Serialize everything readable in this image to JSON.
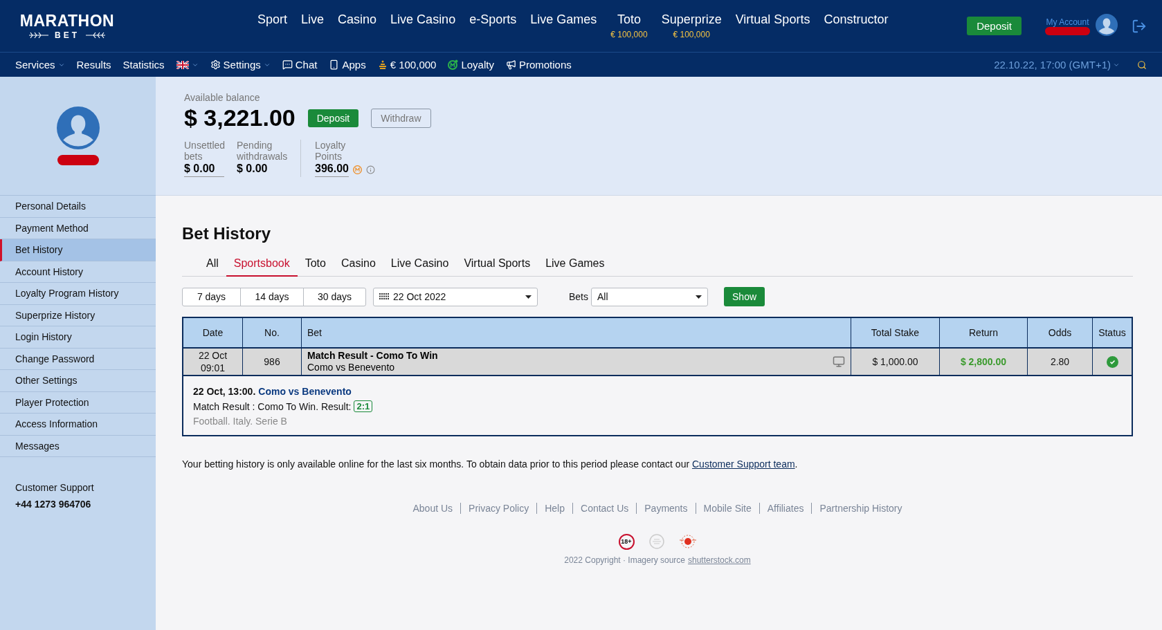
{
  "header": {
    "logo": {
      "title": "MARATHON",
      "subtitle": "BET"
    },
    "nav": [
      {
        "label": "Sport"
      },
      {
        "label": "Live"
      },
      {
        "label": "Casino"
      },
      {
        "label": "Live Casino"
      },
      {
        "label": "e-Sports"
      },
      {
        "label": "Live Games"
      },
      {
        "label": "Toto",
        "sub": "€ 100,000"
      },
      {
        "label": "Superprize",
        "sub": "€ 100,000"
      },
      {
        "label": "Virtual Sports"
      },
      {
        "label": "Constructor"
      }
    ],
    "deposit": "Deposit",
    "account_label": "My Account"
  },
  "subnav": {
    "items": [
      {
        "kind": "dropdown",
        "label": "Services"
      },
      {
        "kind": "link",
        "label": "Results"
      },
      {
        "kind": "link",
        "label": "Statistics"
      },
      {
        "kind": "flag"
      },
      {
        "kind": "settings",
        "label": "Settings"
      },
      {
        "kind": "chat",
        "label": "Chat"
      },
      {
        "kind": "apps",
        "label": "Apps"
      },
      {
        "kind": "jackpot",
        "label": "€ 100,000"
      },
      {
        "kind": "loyalty",
        "label": "Loyalty"
      },
      {
        "kind": "promotions",
        "label": "Promotions"
      }
    ],
    "datetime": "22.10.22, 17:00 (GMT+1)"
  },
  "sidebar": {
    "items": [
      {
        "label": "Personal Details",
        "selected": false
      },
      {
        "label": "Payment Method",
        "selected": false
      },
      {
        "label": "Bet History",
        "selected": true
      },
      {
        "label": "Account History",
        "selected": false
      },
      {
        "label": "Loyalty Program History",
        "selected": false
      },
      {
        "label": "Superprize History",
        "selected": false
      },
      {
        "label": "Login History",
        "selected": false
      },
      {
        "label": "Change Password",
        "selected": false
      },
      {
        "label": "Other Settings",
        "selected": false
      },
      {
        "label": "Player Protection",
        "selected": false
      },
      {
        "label": "Access Information",
        "selected": false
      },
      {
        "label": "Messages",
        "selected": false
      }
    ],
    "support_label": "Customer Support",
    "support_phone": "+44 1273 964706"
  },
  "balance": {
    "label": "Available balance",
    "amount": "$ 3,221.00",
    "deposit": "Deposit",
    "withdraw": "Withdraw",
    "stats": [
      {
        "label": "Unsettled bets",
        "value": "$ 0.00"
      },
      {
        "label": "Pending withdrawals",
        "value": "$ 0.00"
      }
    ],
    "loyalty": {
      "label": "Loyalty Points",
      "value": "396.00"
    }
  },
  "bet_history": {
    "title": "Bet History",
    "tabs": [
      {
        "label": "All",
        "selected": false
      },
      {
        "label": "Sportsbook",
        "selected": true
      },
      {
        "label": "Toto",
        "selected": false
      },
      {
        "label": "Casino",
        "selected": false
      },
      {
        "label": "Live Casino",
        "selected": false
      },
      {
        "label": "Virtual Sports",
        "selected": false
      },
      {
        "label": "Live Games",
        "selected": false
      }
    ],
    "periods": [
      "7 days",
      "14 days",
      "30 days"
    ],
    "date": "22 Oct 2022",
    "bets_label": "Bets",
    "bets_value": "All",
    "show": "Show",
    "table": {
      "columns": [
        "Date",
        "No.",
        "Bet",
        "Total Stake",
        "Return",
        "Odds",
        "Status"
      ],
      "rows": [
        {
          "date": "22 Oct",
          "time": "09:01",
          "no": "986",
          "bet": "Match Result - Como To Win",
          "event": "Como vs Benevento",
          "stake": "$ 1,000.00",
          "return": "$ 2,800.00",
          "odds": "2.80",
          "won": true,
          "details": {
            "time": "22 Oct, 13:00.",
            "event": "Como vs Benevento",
            "market": "Match Result : Como To Win. Result:",
            "score": "2:1",
            "path": "Football. Italy. Serie B"
          }
        }
      ]
    },
    "note": "Your betting history is only available online for the last six months. To obtain data prior to this period please contact our",
    "note_link": "Customer Support team",
    "note_end": "."
  },
  "footer": {
    "links": [
      "About Us",
      "Privacy Policy",
      "Help",
      "Contact Us",
      "Payments",
      "Mobile Site",
      "Affiliates",
      "Partnership History"
    ],
    "age_badge": "18+",
    "copyright": "2022 Copyright · Imagery source",
    "copyright_link": "shutterstock.com"
  }
}
